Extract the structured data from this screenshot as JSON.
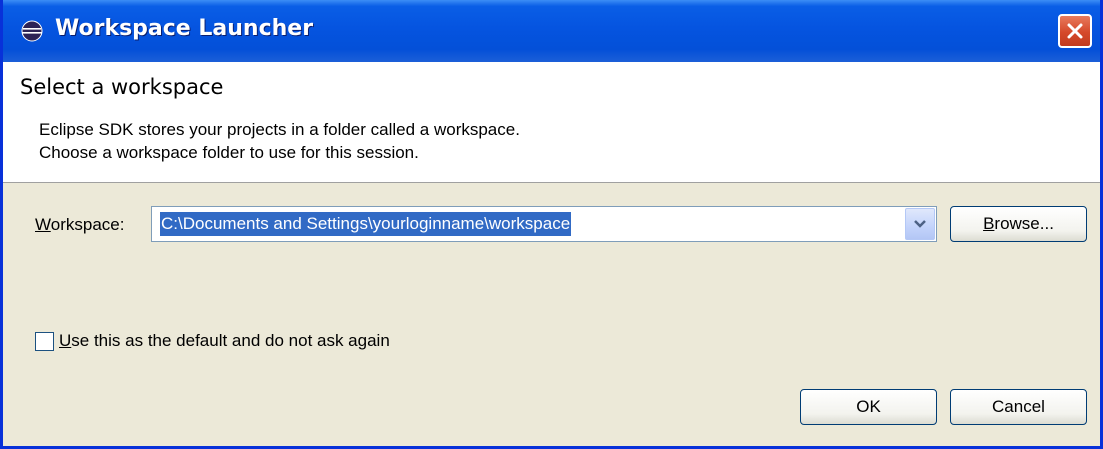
{
  "window": {
    "title": "Workspace Launcher"
  },
  "header": {
    "title": "Select a workspace",
    "description_line1": "Eclipse SDK stores your projects in a folder called a workspace.",
    "description_line2": "Choose a workspace folder to use for this session."
  },
  "workspace": {
    "label_mnemonic": "W",
    "label_rest": "orkspace:",
    "value": "C:\\Documents and Settings\\yourloginname\\workspace"
  },
  "buttons": {
    "browse_mnemonic": "B",
    "browse_rest": "rowse...",
    "ok": "OK",
    "cancel": "Cancel"
  },
  "default_checkbox": {
    "label_mnemonic": "U",
    "label_rest": "se this as the default and do not ask again",
    "checked": false
  },
  "colors": {
    "titlebar": "#0554e0",
    "selection": "#316ac5",
    "dialog_bg": "#ece9d8",
    "close_button": "#d5492a"
  },
  "icons": {
    "app": "eclipse-icon",
    "close": "close-icon",
    "dropdown": "chevron-down-icon"
  }
}
